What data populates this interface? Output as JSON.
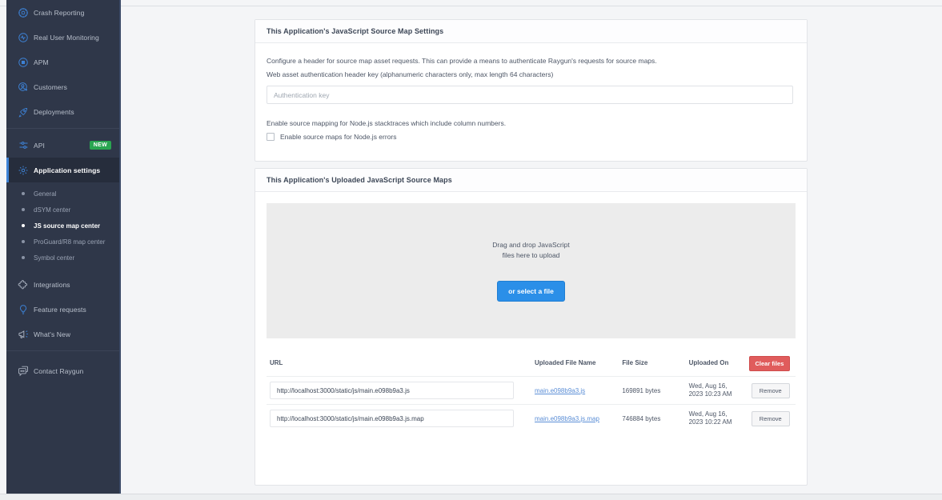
{
  "sidebar": {
    "items": [
      {
        "label": "Crash Reporting",
        "icon": "crash-bug-icon"
      },
      {
        "label": "Real User Monitoring",
        "icon": "pulse-icon"
      },
      {
        "label": "APM",
        "icon": "apm-chart-icon"
      },
      {
        "label": "Customers",
        "icon": "customers-person-icon"
      },
      {
        "label": "Deployments",
        "icon": "rocket-icon"
      }
    ],
    "group2": [
      {
        "label": "API",
        "icon": "api-nodes-icon",
        "badge": "NEW"
      },
      {
        "label": "Application settings",
        "icon": "gear-icon",
        "active": true
      }
    ],
    "subitems": [
      {
        "label": "General",
        "active": false
      },
      {
        "label": "dSYM center",
        "active": false
      },
      {
        "label": "JS source map center",
        "active": true
      },
      {
        "label": "ProGuard/R8 map center",
        "active": false
      },
      {
        "label": "Symbol center",
        "active": false
      }
    ],
    "group3": [
      {
        "label": "Integrations",
        "icon": "puzzle-icon"
      },
      {
        "label": "Feature requests",
        "icon": "lightbulb-icon"
      },
      {
        "label": "What's New",
        "icon": "megaphone-icon"
      }
    ],
    "group4": [
      {
        "label": "Contact Raygun",
        "icon": "chat-bubbles-icon"
      }
    ]
  },
  "settings_card": {
    "title": "This Application's JavaScript Source Map Settings",
    "description": "Configure a header for source map asset requests. This can provide a means to authenticate Raygun's requests for source maps.",
    "field_label": "Web asset authentication header key (alphanumeric characters only, max length 64 characters)",
    "auth_placeholder": "Authentication key",
    "auth_value": "",
    "node_description": "Enable source mapping for Node.js stacktraces which include column numbers.",
    "node_checkbox_label": "Enable source maps for Node.js errors",
    "node_checkbox_checked": false
  },
  "uploads_card": {
    "title": "This Application's Uploaded JavaScript Source Maps",
    "dropzone_line1": "Drag and drop JavaScript",
    "dropzone_line2": "files here to upload",
    "select_file_button": "or select a file",
    "table": {
      "headers": {
        "url": "URL",
        "filename": "Uploaded File Name",
        "filesize": "File Size",
        "uploaded_on": "Uploaded On"
      },
      "clear_files_button": "Clear files",
      "remove_button": "Remove",
      "rows": [
        {
          "url": "http://localhost:3000/static/js/main.e098b9a3.js",
          "filename": "main.e098b9a3.js",
          "filesize": "169891 bytes",
          "uploaded_on": "Wed, Aug 16, 2023 10:23 AM"
        },
        {
          "url": "http://localhost:3000/static/js/main.e098b9a3.js.map",
          "filename": "main.e098b9a3.js.map",
          "filesize": "746884 bytes",
          "uploaded_on": "Wed, Aug 16, 2023 10:22 AM"
        }
      ]
    }
  },
  "colors": {
    "sidebar_bg": "#2f3749",
    "sidebar_active_bg": "#262d3c",
    "accent_blue": "#3d82d6",
    "primary_button": "#2b8fe8",
    "danger_button": "#e05c5c",
    "badge_green": "#2aa551",
    "page_bg": "#f4f5f7"
  }
}
